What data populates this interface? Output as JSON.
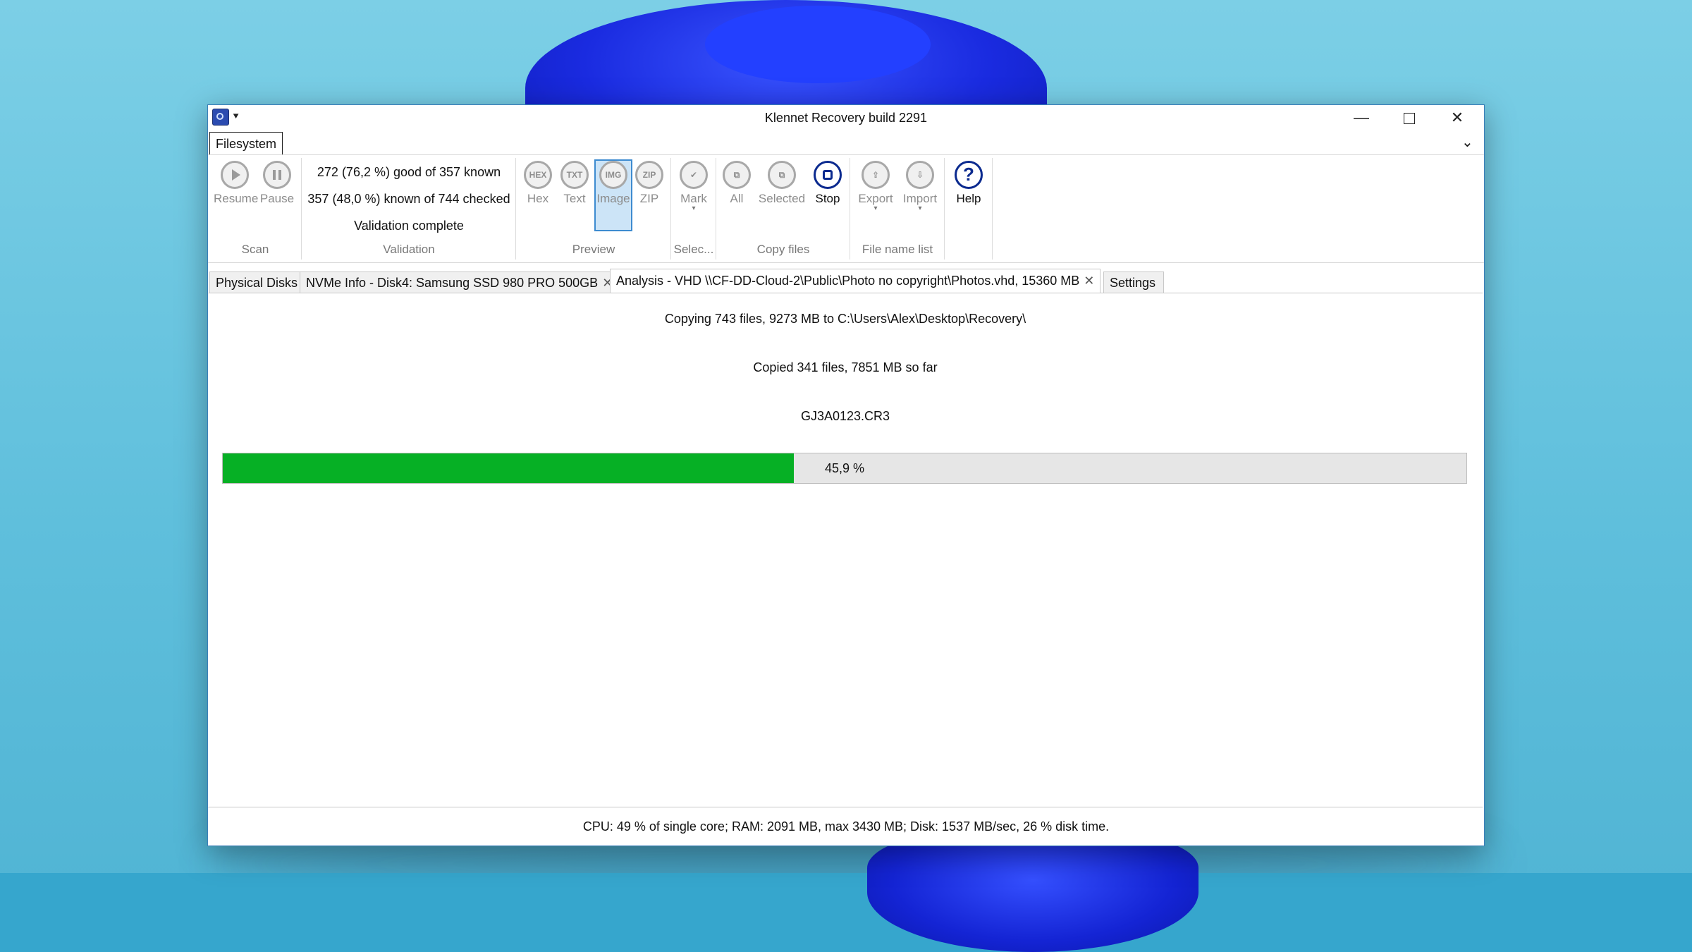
{
  "window": {
    "title": "Klennet Recovery build 2291"
  },
  "ribbon": {
    "tab": "Filesystem",
    "groups": {
      "scan": {
        "label": "Scan",
        "resume": "Resume",
        "pause": "Pause"
      },
      "validation": {
        "label": "Validation",
        "line1": "272 (76,2 %) good of 357 known",
        "line2": "357 (48,0 %) known of 744 checked",
        "line3": "Validation complete"
      },
      "preview": {
        "label": "Preview",
        "hex": "Hex",
        "text": "Text",
        "image": "Image",
        "zip": "ZIP",
        "hex_icon": "HEX",
        "text_icon": "TXT",
        "image_icon": "IMG",
        "zip_icon": "ZIP"
      },
      "selection": {
        "label": "Selec...",
        "mark": "Mark"
      },
      "copy": {
        "label": "Copy files",
        "all": "All",
        "selected": "Selected",
        "stop": "Stop"
      },
      "filenames": {
        "label": "File name list",
        "export": "Export",
        "import": "Import"
      },
      "help": {
        "label": "Help"
      }
    }
  },
  "tabs": [
    {
      "label": "Physical Disks"
    },
    {
      "label": "NVMe Info - Disk4:  Samsung SSD 980 PRO 500GB"
    },
    {
      "label": "Analysis - VHD \\\\CF-DD-Cloud-2\\Public\\Photo no copyright\\Photos.vhd, 15360 MB"
    },
    {
      "label": "Settings"
    }
  ],
  "copy_progress": {
    "line1": "Copying 743 files, 9273 MB to C:\\Users\\Alex\\Desktop\\Recovery\\",
    "line2": "Copied 341 files, 7851 MB so far",
    "current_file": "GJ3A0123.CR3",
    "percent_text": "45,9 %",
    "percent": 45.9,
    "bar_color": "#06b025"
  },
  "status": {
    "text": "CPU: 49 % of single core; RAM: 2091 MB, max 3430 MB; Disk: 1537 MB/sec, 26 % disk time."
  }
}
